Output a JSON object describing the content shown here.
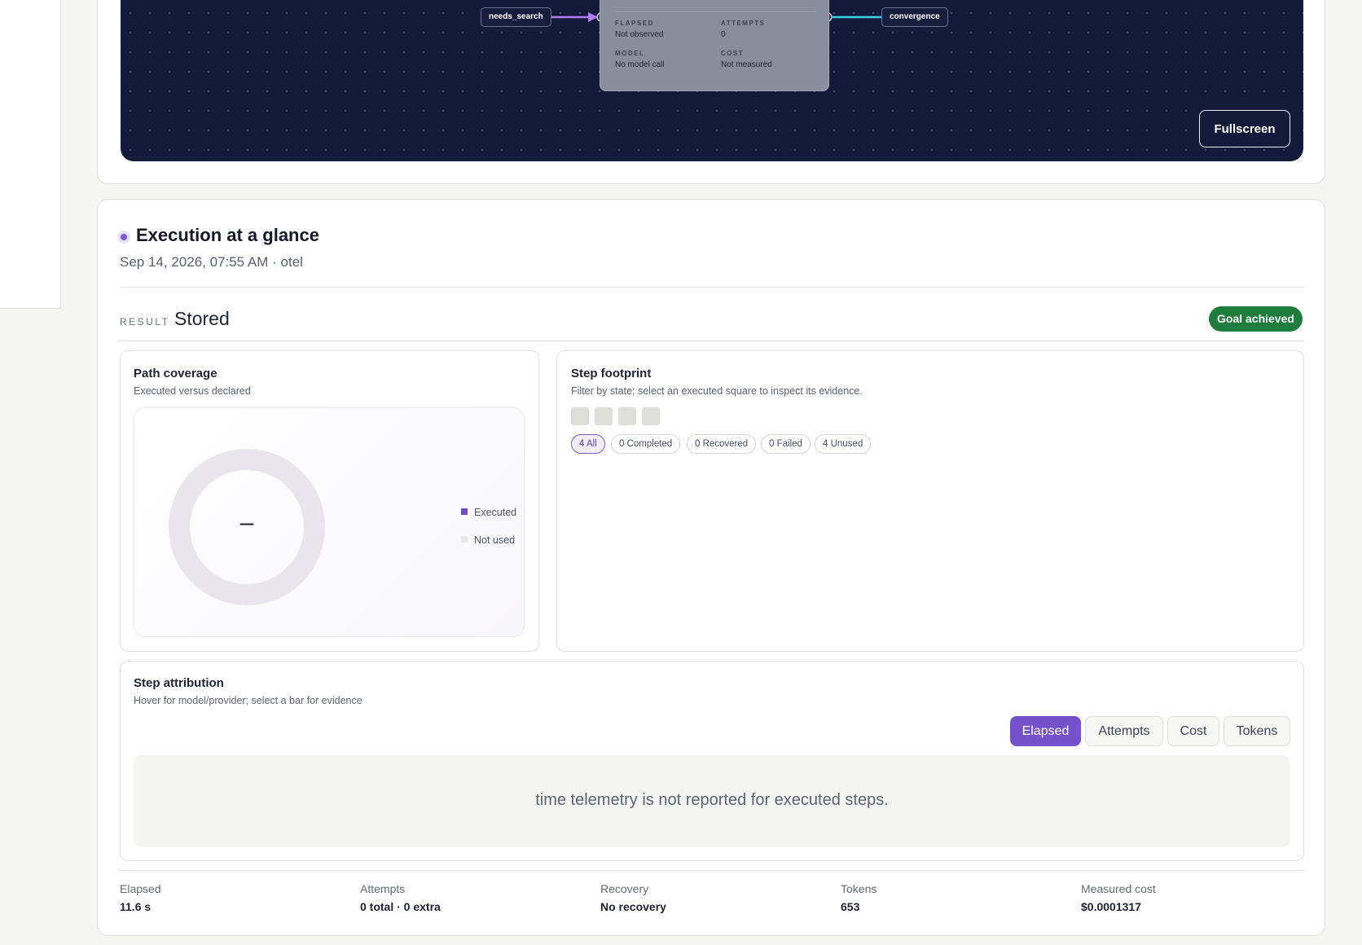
{
  "graph": {
    "nodes": {
      "left_label": "needs_search",
      "right_label": "convergence"
    },
    "node_card": {
      "elapsed_label": "FLAPSED",
      "elapsed_value": "Not observed",
      "attempts_label": "ATTEMPTS",
      "attempts_value": "0",
      "model_label": "MODEL",
      "model_value": "No model call",
      "cost_label": "COST",
      "cost_value": "Not measured"
    },
    "fullscreen_label": "Fullscreen",
    "colors": {
      "canvas": "#131a3a",
      "edge_left": "#b77cf0",
      "edge_right": "#3ed1ea"
    }
  },
  "execution": {
    "title": "Execution at a glance",
    "subtitle": "Sep 14, 2026, 07:55 AM · otel",
    "result_label": "RESULT",
    "result_value": "Stored",
    "goal_badge": "Goal achieved"
  },
  "path_coverage": {
    "title": "Path coverage",
    "subtitle": "Executed versus declared",
    "center_value": "–",
    "legend": [
      {
        "label": "Executed",
        "color": "#6f4fc6"
      },
      {
        "label": "Not used",
        "color": "#e8e6ec"
      }
    ]
  },
  "step_footprint": {
    "title": "Step footprint",
    "subtitle": "Filter by state; select an executed square to inspect its evidence.",
    "squares": 4,
    "chips": [
      "4 All",
      "0 Completed",
      "0 Recovered",
      "0 Failed",
      "4 Unused"
    ]
  },
  "step_attribution": {
    "title": "Step attribution",
    "subtitle": "Hover for model/provider; select a bar for evidence",
    "tabs": [
      "Elapsed",
      "Attempts",
      "Cost",
      "Tokens"
    ],
    "active_tab": "Elapsed",
    "empty_message": "time telemetry is not reported for executed steps."
  },
  "stats": [
    {
      "label": "Elapsed",
      "value": "11.6 s"
    },
    {
      "label": "Attempts",
      "value": "0 total · 0 extra"
    },
    {
      "label": "Recovery",
      "value": "No recovery"
    },
    {
      "label": "Tokens",
      "value": "653"
    },
    {
      "label": "Measured cost",
      "value": "$0.0001317"
    }
  ]
}
